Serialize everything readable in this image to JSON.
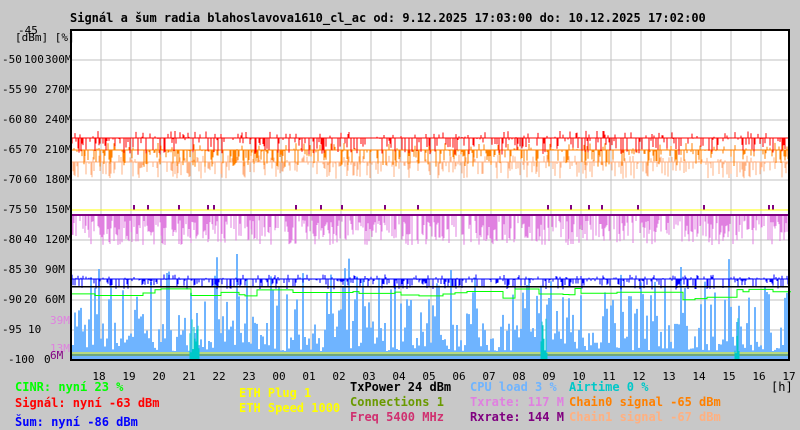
{
  "title": "Signál a šum radia blahoslavova1610_cl_ac od: 9.12.2025 17:03:00 do: 10.12.2025 17:02:00",
  "chart_data": {
    "type": "line",
    "title": "Signál a šum radia blahoslavova1610_cl_ac od: 9.12.2025 17:03:00 do: 10.12.2025 17:02:00",
    "xlabel": "[h]",
    "ylabel": "[dBm] [%]",
    "x_ticks": [
      "18",
      "19",
      "20",
      "21",
      "22",
      "23",
      "00",
      "01",
      "02",
      "03",
      "04",
      "05",
      "06",
      "07",
      "08",
      "09",
      "10",
      "11",
      "12",
      "13",
      "14",
      "15",
      "16",
      "17"
    ],
    "y_ticks_dbm": [
      "-45",
      "-50",
      "-55",
      "-60",
      "-65",
      "-70",
      "-75",
      "-80",
      "-85",
      "-90",
      "-95",
      "-100"
    ],
    "y_ticks_percent": [
      "100",
      "90",
      "80",
      "70",
      "60",
      "50",
      "40",
      "30",
      "20",
      "10",
      "0"
    ],
    "y_ticks_rate": [
      "300M",
      "270M",
      "240M",
      "210M",
      "180M",
      "150M",
      "120M",
      "90M",
      "60M"
    ],
    "rate_markers": [
      "39M",
      "13M",
      "6M"
    ],
    "ylim_dbm": [
      -100,
      -45
    ],
    "grid": true,
    "series": [
      {
        "name": "Signál",
        "unit": "dBm",
        "typical": -62.5,
        "now": -63,
        "color": "#ff0000"
      },
      {
        "name": "Chain0 signal",
        "unit": "dBm",
        "typical": -65,
        "now": -65,
        "color": "#ff8000"
      },
      {
        "name": "Chain1 signal",
        "unit": "dBm",
        "typical": -67,
        "now": -67,
        "color": "#ffb080"
      },
      {
        "name": "Šum",
        "unit": "dBm",
        "typical": -86,
        "now": -86,
        "color": "#0000ff"
      },
      {
        "name": "CINR",
        "unit": "%",
        "typical": 22,
        "now": 23,
        "color": "#00ff00"
      },
      {
        "name": "CPU load",
        "unit": "%",
        "typical": 12,
        "now": 3,
        "color": "#6fb4ff"
      },
      {
        "name": "Airtime",
        "unit": "%",
        "typical": 0,
        "now": 0,
        "color": "#00c8c8"
      },
      {
        "name": "Txrate",
        "unit": "M",
        "typical": 130,
        "now": 117,
        "color": "#e080e0"
      },
      {
        "name": "Rxrate",
        "unit": "M",
        "typical": 144,
        "now": 144,
        "color": "#800080"
      },
      {
        "name": "ETH Speed",
        "unit": "M",
        "typical": 150,
        "color": "#ffff00"
      },
      {
        "name": "TxPower",
        "unit": "dBm",
        "typical": -88,
        "color": "#000000"
      },
      {
        "name": "Connections",
        "typical": 1,
        "color": "#6a9a00"
      }
    ]
  },
  "legend": {
    "cinr": "CINR: nyní 23 %",
    "signal": "Signál: nyní -63 dBm",
    "noise": "Šum: nyní -86 dBm",
    "eth_plug": "ETH Plug 1",
    "eth_speed": "ETH Speed 1000",
    "txpower": "TxPower 24 dBm",
    "connections": "Connections 1",
    "freq": "Freq 5400 MHz",
    "cpu": "CPU load 3 %",
    "txrate": "Txrate: 117 M",
    "rxrate": "Rxrate: 144 M",
    "airtime": "Airtime 0 %",
    "chain0": "Chain0 signal -65 dBm",
    "chain1": "Chain1 signal -67 dBm"
  },
  "colors": {
    "background": "#c8c8c8",
    "plot": "#ffffff",
    "grid": "#c0c0c0",
    "cinr": "#00ff00",
    "signal": "#ff0000",
    "noise": "#0000ff",
    "eth": "#ffff00",
    "txpower": "#000000",
    "connections": "#6a9a00",
    "freq": "#d03070",
    "cpu": "#6fb4ff",
    "txrate": "#e080e0",
    "rxrate": "#800080",
    "airtime": "#00c8c8",
    "chain0": "#ff8000",
    "chain1": "#ffb080"
  }
}
